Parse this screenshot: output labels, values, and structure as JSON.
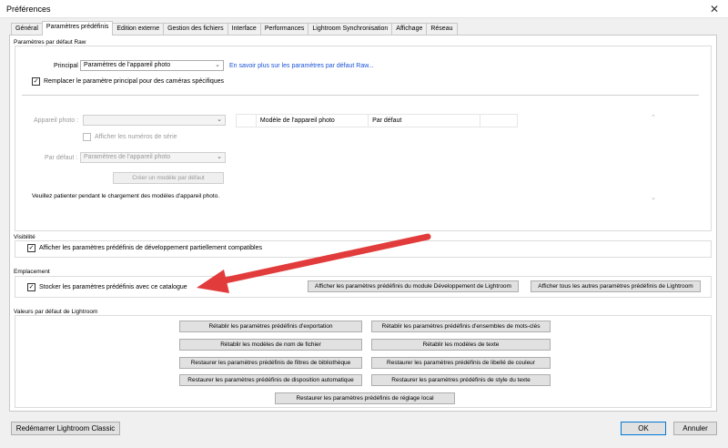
{
  "window": {
    "title": "Préférences"
  },
  "tabs": [
    {
      "label": "Général"
    },
    {
      "label": "Paramètres prédéfinis"
    },
    {
      "label": "Edition externe"
    },
    {
      "label": "Gestion des fichiers"
    },
    {
      "label": "Interface"
    },
    {
      "label": "Performances"
    },
    {
      "label": "Lightroom Synchronisation"
    },
    {
      "label": "Affichage"
    },
    {
      "label": "Réseau"
    }
  ],
  "raw": {
    "group_label": "Paramètres par défaut Raw",
    "principal_label": "Principal :",
    "principal_value": "Paramètres de l'appareil photo",
    "learn_more": "En savoir plus sur les paramètres par défaut Raw...",
    "replace_label": "Remplacer le paramètre principal pour des caméras spécifiques",
    "replace_checked": true,
    "camera_label": "Appareil photo :",
    "camera_value": "",
    "serial_label": "Afficher les numéros de série",
    "default_label": "Par défaut :",
    "default_value": "Paramètres de l'appareil photo",
    "create_button": "Créer un modèle par défaut",
    "loading_text": "Veuillez patienter pendant le chargement des modèles d'appareil photo.",
    "table_headers": [
      "",
      "Modèle de l'appareil photo",
      "Par défaut",
      ""
    ]
  },
  "visibility": {
    "group_label": "Visibilité",
    "checkbox_label": "Afficher les paramètres prédéfinis de développement partiellement compatibles",
    "checked": true
  },
  "location": {
    "group_label": "Emplacement",
    "checkbox_label": "Stocker les paramètres prédéfinis avec ce catalogue",
    "checked": true,
    "btn_develop": "Afficher les paramètres prédéfinis du module Développement de Lightroom",
    "btn_others": "Afficher tous les autres paramètres prédéfinis de Lightroom"
  },
  "defaults": {
    "group_label": "Valeurs par défaut de Lightroom",
    "buttons": [
      "Rétablir les paramètres prédéfinis d'exportation",
      "Rétablir les paramètres prédéfinis d'ensembles de mots-clés",
      "Rétablir les modèles de nom de fichier",
      "Rétablir les modèles de texte",
      "Restaurer les paramètres prédéfinis de filtres de bibliothèque",
      "Restaurer les paramètres prédéfinis de libellé de couleur",
      "Restaurer les paramètres prédéfinis de disposition automatique",
      "Restaurer les paramètres prédéfinis de style du texte",
      "Restaurer les paramètres prédéfinis de réglage local"
    ]
  },
  "footer": {
    "restart": "Redémarrer Lightroom Classic",
    "ok": "OK",
    "cancel": "Annuler"
  },
  "colors": {
    "arrow": "#e23b3b",
    "link": "#1a53d6"
  }
}
